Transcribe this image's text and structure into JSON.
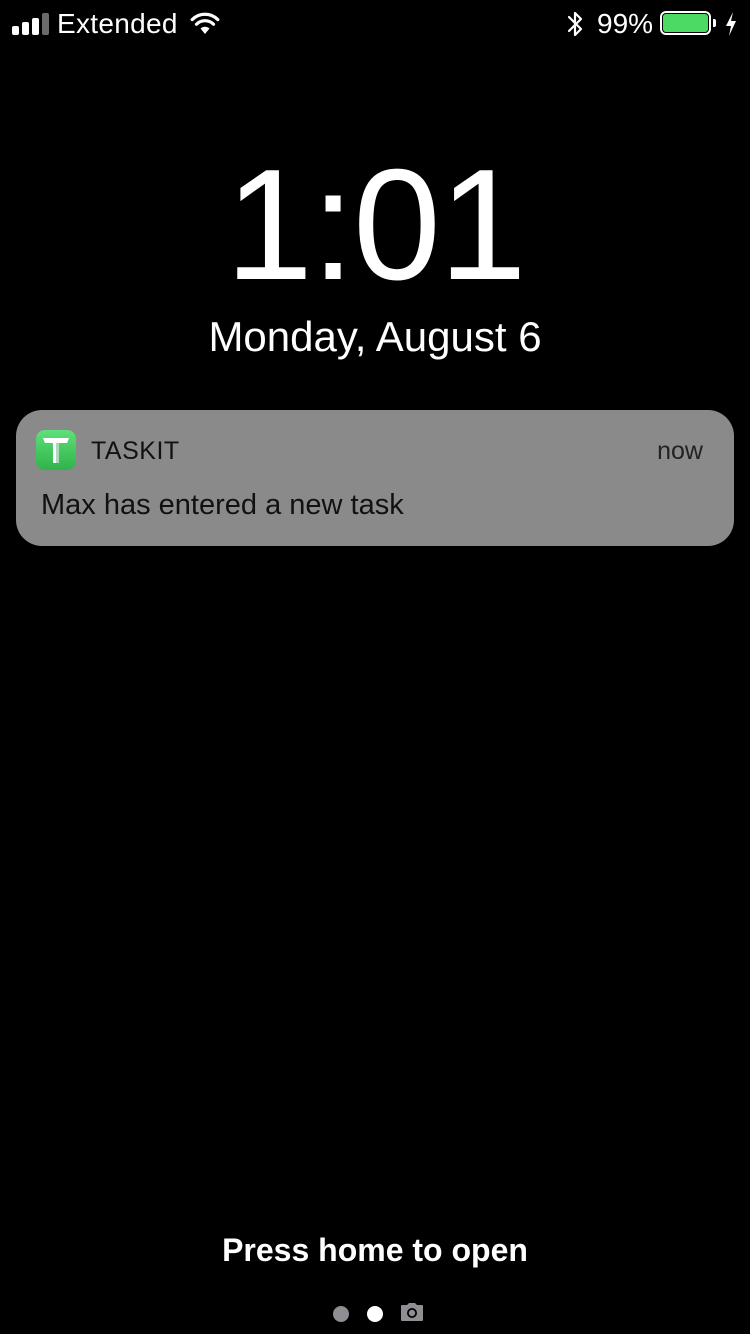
{
  "status_bar": {
    "carrier": "Extended",
    "signal_bars_filled": 3,
    "signal_bars_total": 4,
    "wifi_icon": "wifi-icon",
    "bluetooth_icon": "bluetooth-icon",
    "battery_percent_label": "99%",
    "battery_level": 0.99,
    "charging_icon": "charging-bolt-icon"
  },
  "lock_screen": {
    "time": "1:01",
    "date": "Monday, August 6"
  },
  "notification": {
    "app_icon": "taskit-app-icon",
    "app_name": "TASKIT",
    "time": "now",
    "message": "Max has entered a new task"
  },
  "footer": {
    "hint": "Press home to open",
    "page_indicator": {
      "pages": 2,
      "current_page": 2,
      "camera_icon": "camera-icon"
    }
  },
  "colors": {
    "background": "#000000",
    "text": "#ffffff",
    "battery_fill": "#4cd964",
    "notification_background": "#8a8a8a",
    "app_icon_green": "#3fc45a",
    "dot_inactive": "#8e8e93",
    "dot_active": "#ffffff"
  }
}
